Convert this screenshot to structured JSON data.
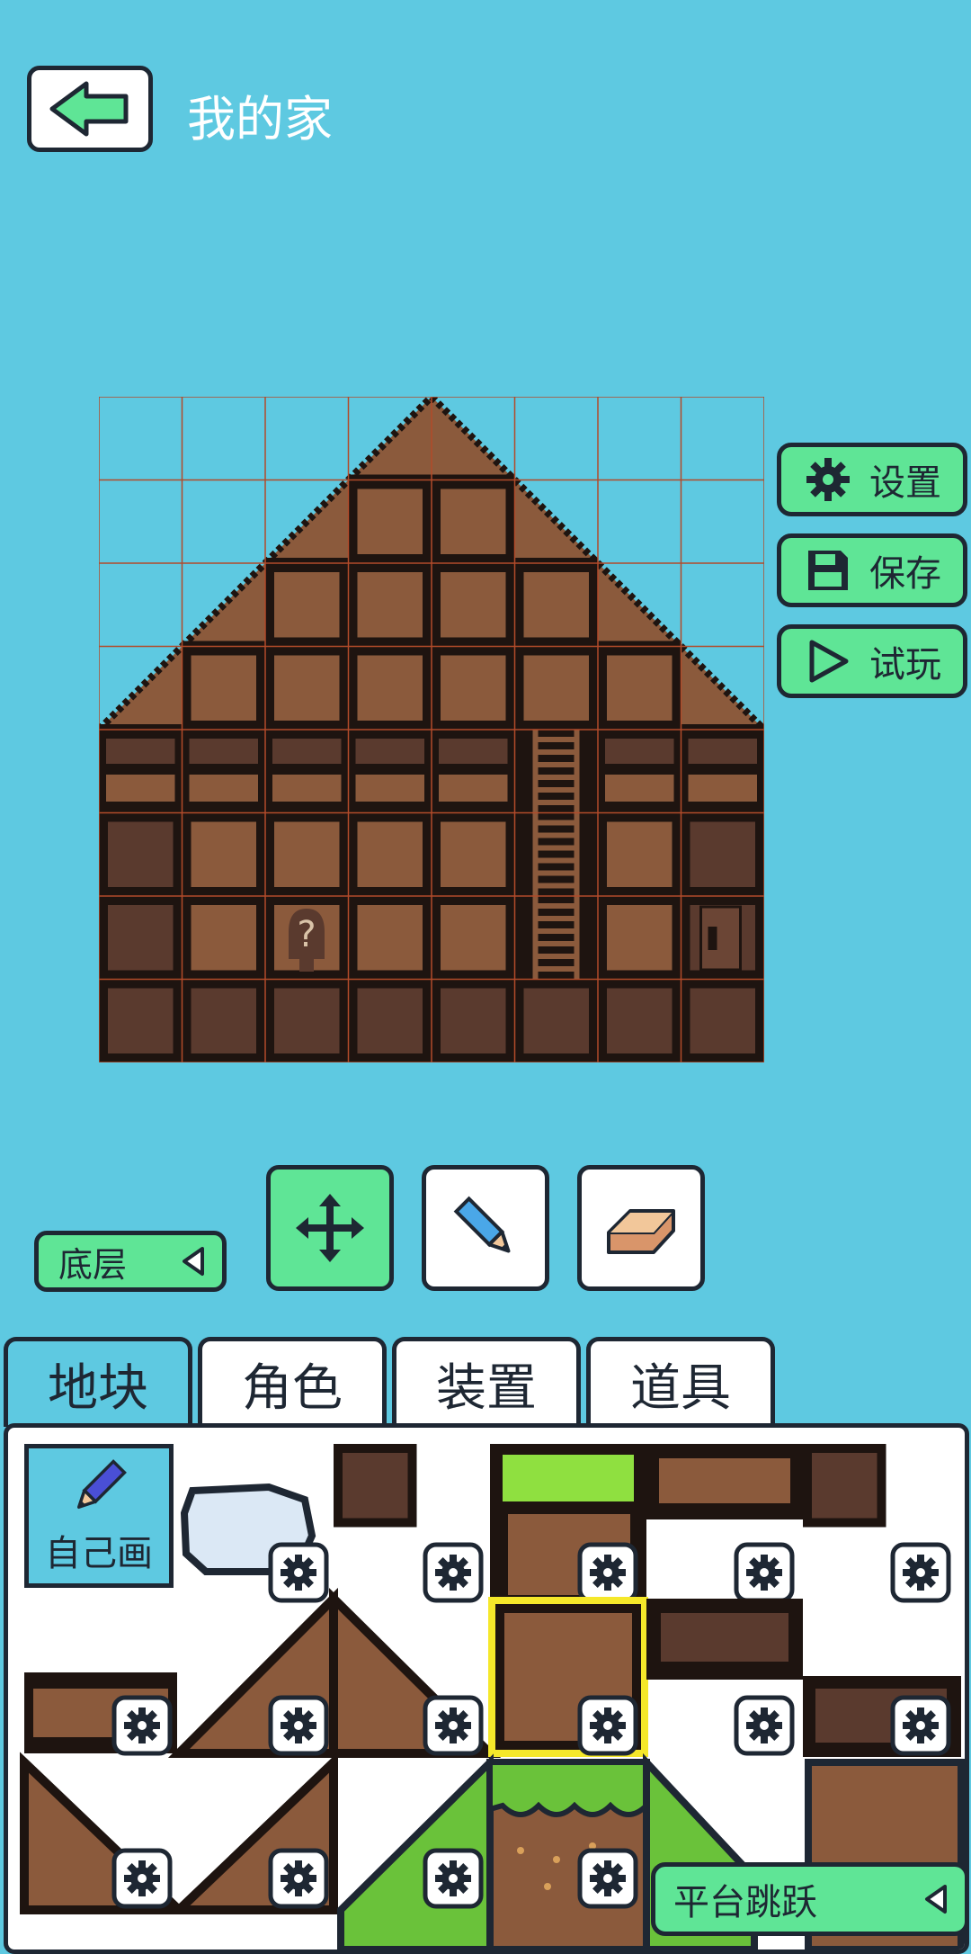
{
  "header": {
    "title": "我的家",
    "back_icon": "arrow-left-icon"
  },
  "side_buttons": [
    {
      "label": "设置",
      "icon": "gear-icon"
    },
    {
      "label": "保存",
      "icon": "floppy-disk-icon"
    },
    {
      "label": "试玩",
      "icon": "play-icon"
    }
  ],
  "tools": [
    {
      "name": "move-tool",
      "icon": "move-arrows-icon",
      "selected": true
    },
    {
      "name": "pencil-tool",
      "icon": "pencil-icon",
      "selected": false
    },
    {
      "name": "eraser-tool",
      "icon": "eraser-icon",
      "selected": false
    }
  ],
  "layer": {
    "label": "底层",
    "icon": "triangle-left-icon"
  },
  "tabs": [
    {
      "label": "地块",
      "active": true
    },
    {
      "label": "角色",
      "active": false
    },
    {
      "label": "装置",
      "active": false
    },
    {
      "label": "道具",
      "active": false
    }
  ],
  "palette": {
    "draw_own_label": "自己画",
    "category_label": "平台跳跃",
    "selected_tile": "brown-block"
  },
  "colors": {
    "background": "#5ec9e1",
    "accent_green": "#5fe596",
    "brown": "#8b5a3c",
    "dark_brown": "#5a3a2e",
    "outline": "#1e2733",
    "selection": "#f5e82a"
  }
}
